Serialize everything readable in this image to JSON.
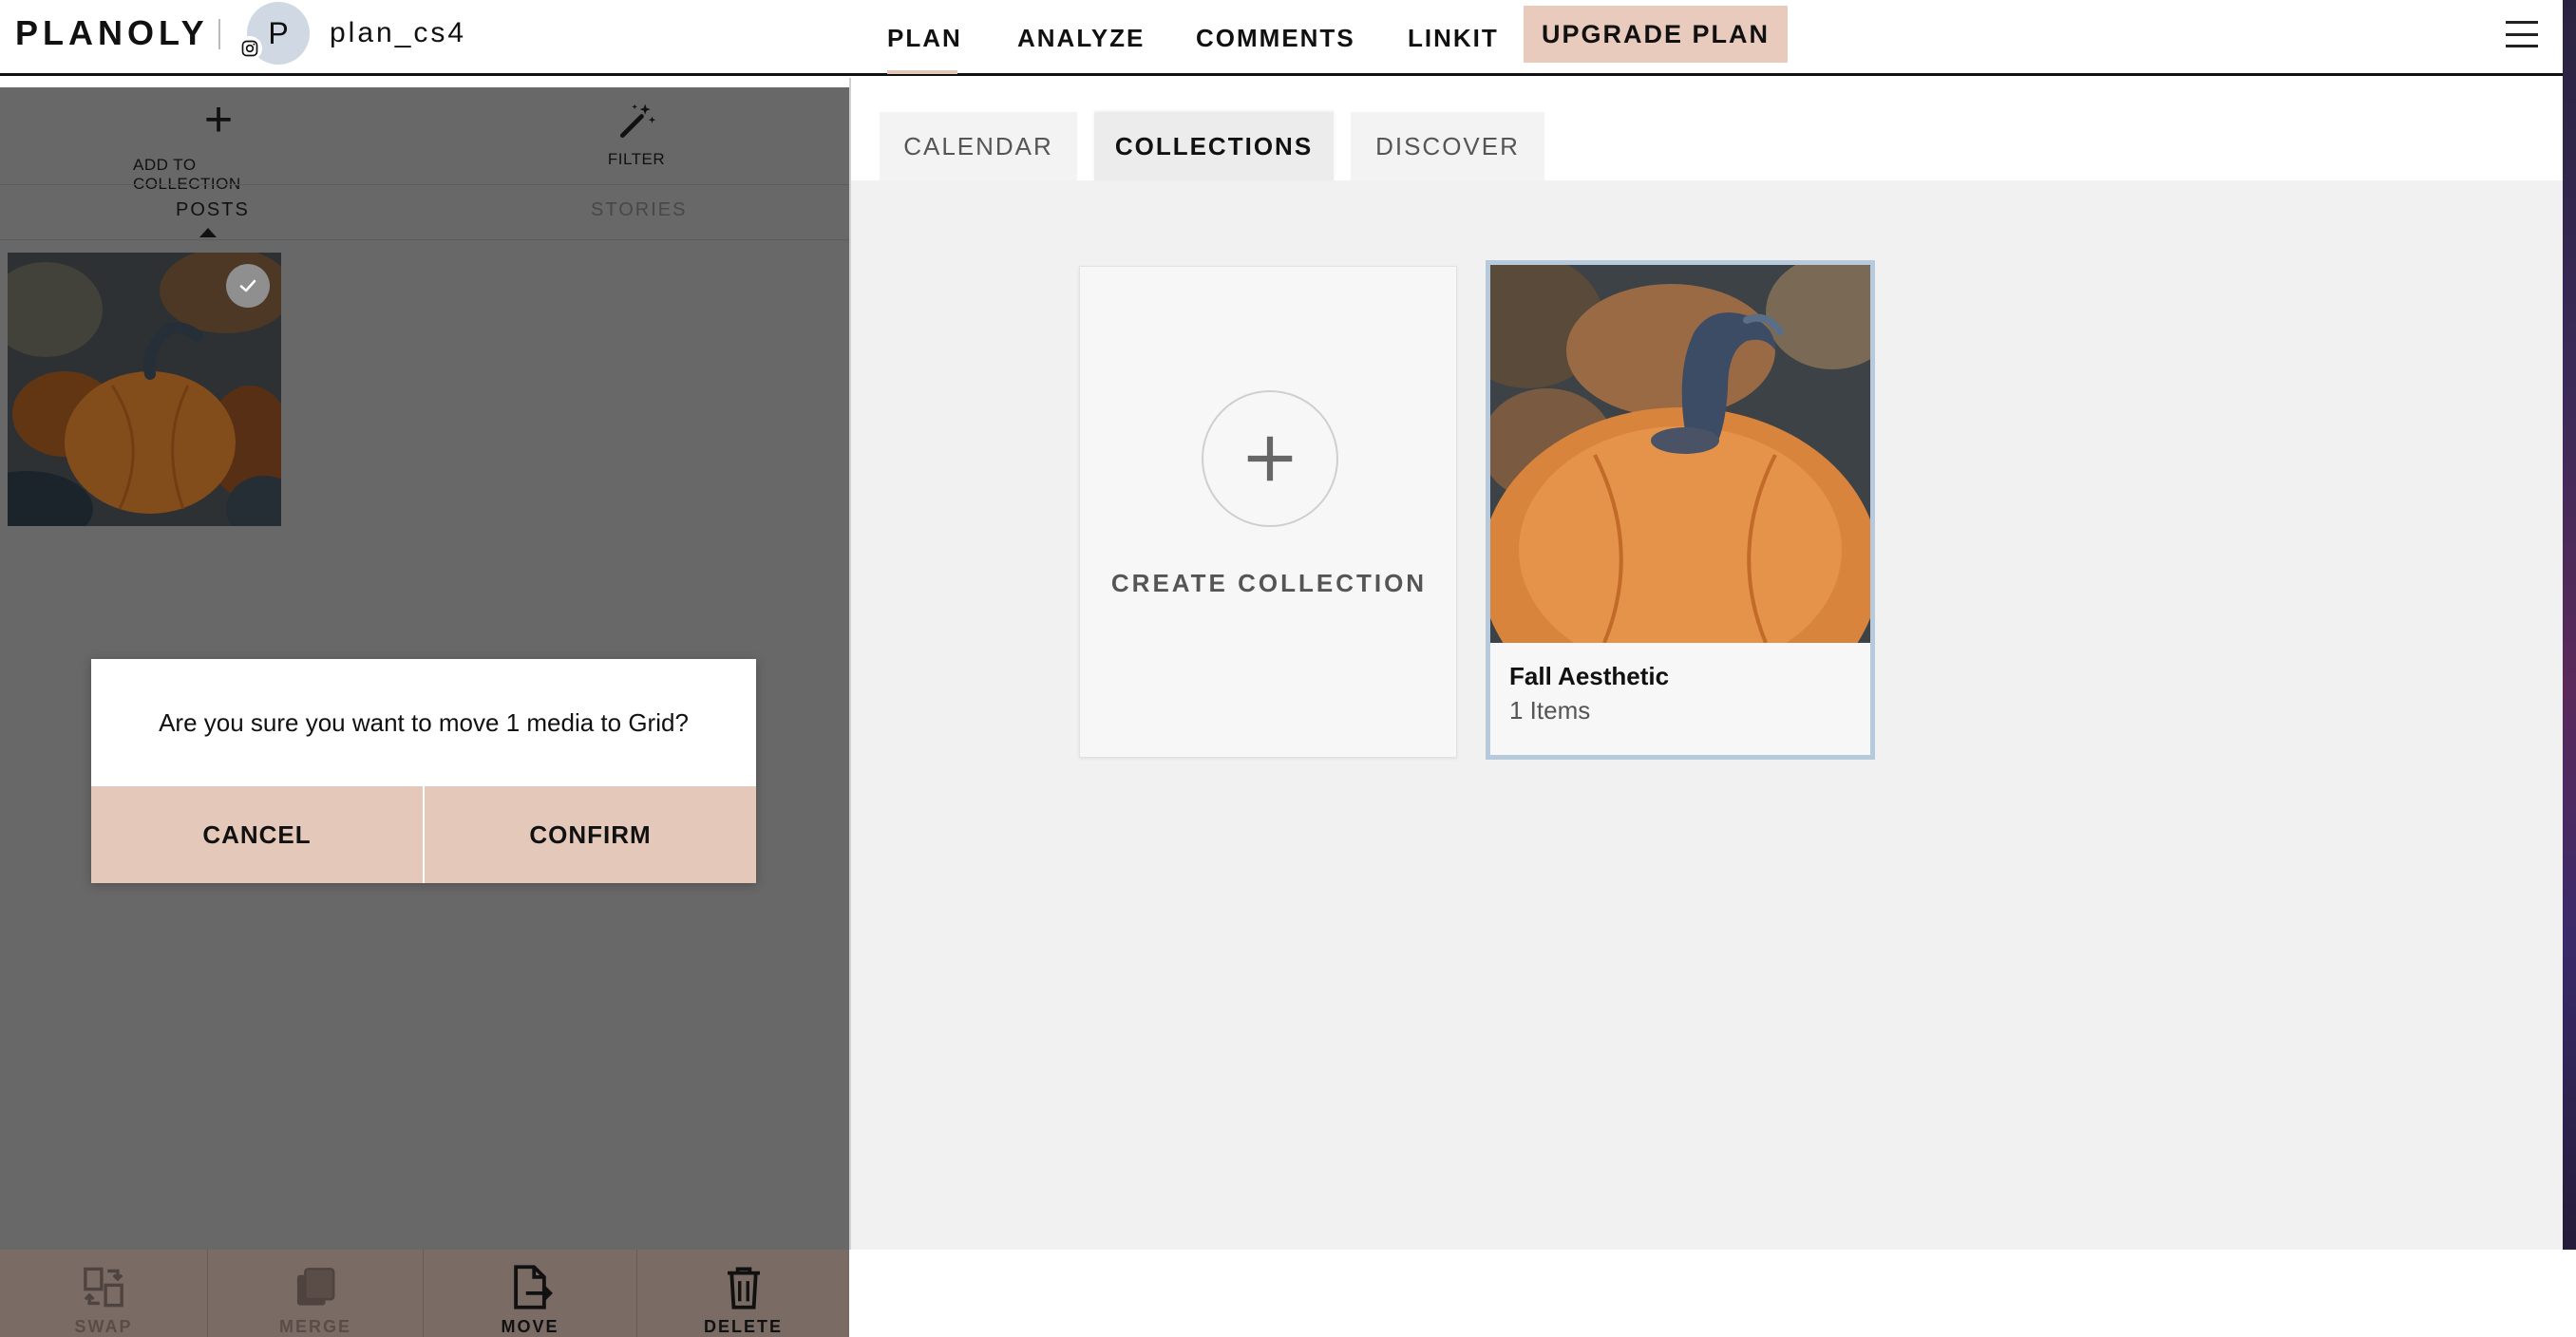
{
  "topbar": {
    "logo": "PLANOLY",
    "avatar_initial": "P",
    "username": "plan_cs4",
    "nav": {
      "plan": "PLAN",
      "analyze": "ANALYZE",
      "comments": "COMMENTS",
      "linkit": "LINKIT",
      "upgrade": "UPGRADE PLAN"
    },
    "active_nav": "PLAN",
    "accent_color": "#e8cbbc"
  },
  "left_panel": {
    "toolbar": {
      "add_to_collection": "ADD TO COLLECTION",
      "filter": "FILTER"
    },
    "tabs": {
      "posts": "POSTS",
      "stories": "STORIES"
    },
    "active_tab": "POSTS",
    "media_selected_count": 1,
    "dialog": {
      "message": "Are you sure you want to move 1 media to Grid?",
      "cancel": "CANCEL",
      "confirm": "CONFIRM"
    },
    "bottom_actions": [
      {
        "icon": "swap-icon",
        "label": "SWAP",
        "enabled": false
      },
      {
        "icon": "merge-icon",
        "label": "MERGE",
        "enabled": false
      },
      {
        "icon": "move-icon",
        "label": "MOVE",
        "enabled": true
      },
      {
        "icon": "delete-icon",
        "label": "DELETE",
        "enabled": true
      }
    ]
  },
  "right_panel": {
    "subtabs": {
      "calendar": "CALENDAR",
      "collections": "COLLECTIONS",
      "discover": "DISCOVER"
    },
    "active_subtab": "COLLECTIONS",
    "create_collection": "CREATE COLLECTION",
    "collections": [
      {
        "name": "Fall Aesthetic",
        "count": "1 Items",
        "selected": true
      }
    ]
  }
}
